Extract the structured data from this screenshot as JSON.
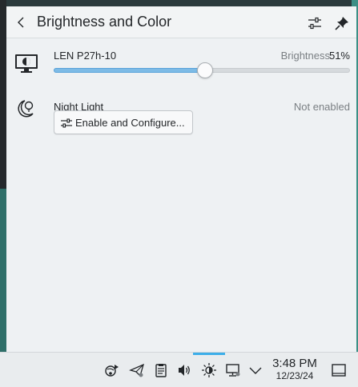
{
  "header": {
    "title": "Brightness and Color"
  },
  "display": {
    "name": "LEN P27h-10",
    "brightness_label": "Brightness",
    "brightness_value": "51%",
    "brightness_fraction": 0.51
  },
  "night_light": {
    "label": "Night Light",
    "status": "Not enabled",
    "button_label": "Enable and Configure..."
  },
  "taskbar": {
    "time": "3:48 PM",
    "date": "12/23/24",
    "tray_icons": [
      "network-share-icon",
      "telegram-icon",
      "clipboard-icon",
      "volume-icon",
      "brightness-icon",
      "network-icon",
      "expand-tray-icon"
    ]
  },
  "colors": {
    "accent": "#3daee9",
    "slider_fill": "#7dbbe6"
  }
}
